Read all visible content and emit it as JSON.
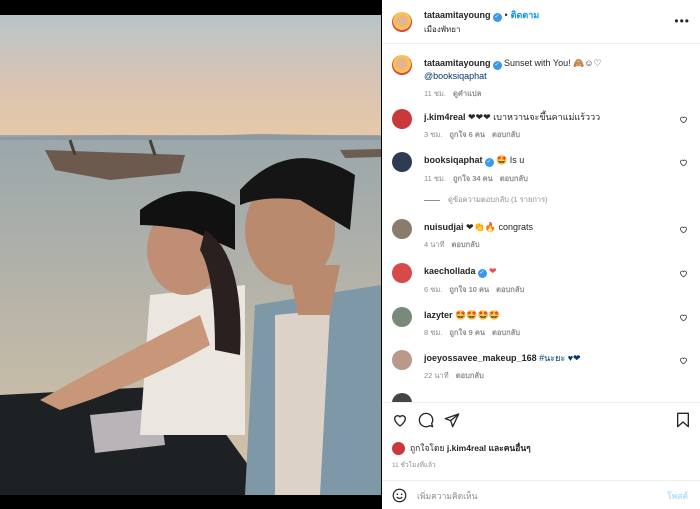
{
  "post": {
    "author": "tataamitayoung",
    "follow_label": "ติดตาม",
    "location": "เมืองพัทยา",
    "caption_text": "Sunset with You! 🙈☺♡",
    "caption_mention": "@booksiqaphat",
    "caption_time": "11 ชม.",
    "translate_label": "ดูคำแปล"
  },
  "comments": [
    {
      "user": "j.kim4real",
      "text": "❤❤❤ เบาหวานจะขึ้นคาแม่แร้ววว",
      "time": "3 ชม.",
      "likes": "ถูกใจ 6 คน",
      "reply": "ตอบกลับ",
      "avatar_color": "#c9383a",
      "verified": false
    },
    {
      "user": "booksiqaphat",
      "text": "🤩 Is u",
      "time": "11 ชม.",
      "likes": "ถูกใจ 34 คน",
      "reply": "ตอบกลับ",
      "avatar_color": "#2f3b52",
      "verified": true
    },
    {
      "user": "nuisudjai",
      "text": "❤👏🔥 congrats",
      "time": "4 นาที",
      "likes": "",
      "reply": "ตอบกลับ",
      "avatar_color": "#8a7b6c",
      "verified": false
    },
    {
      "user": "kaechollada",
      "text": "❤",
      "time": "6 ชม.",
      "likes": "ถูกใจ 10 คน",
      "reply": "ตอบกลับ",
      "avatar_color": "#d64a4a",
      "verified": true
    },
    {
      "user": "lazyter",
      "text": "🤩🤩🤩🤩",
      "time": "8 ชม.",
      "likes": "ถูกใจ 9 คน",
      "reply": "ตอบกลับ",
      "avatar_color": "#7a8a7a",
      "verified": false
    },
    {
      "user": "joeyossavee_makeup_168",
      "text": "#นะยะ ♥❤",
      "time": "22 นาที",
      "likes": "",
      "reply": "ตอบกลับ",
      "avatar_color": "#b99a8a",
      "verified": false
    }
  ],
  "view_replies": "ดูข้อความตอบกลับ (1 รายการ)",
  "likes_line": {
    "prefix": "ถูกใจโดย",
    "user": "j.kim4real",
    "suffix": "และคนอื่นๆ"
  },
  "post_time": "11 ชั่วโมงที่แล้ว",
  "comment_placeholder": "เพิ่มความคิดเห็น",
  "post_button": "โพสต์",
  "colors": {
    "accent": "#0095f6",
    "heart_red": "#ed4956",
    "muted": "#8e8e8e"
  },
  "icons": [
    "heart-icon",
    "comment-icon",
    "share-icon",
    "bookmark-icon",
    "emoji-icon",
    "more-icon",
    "verified-icon"
  ]
}
